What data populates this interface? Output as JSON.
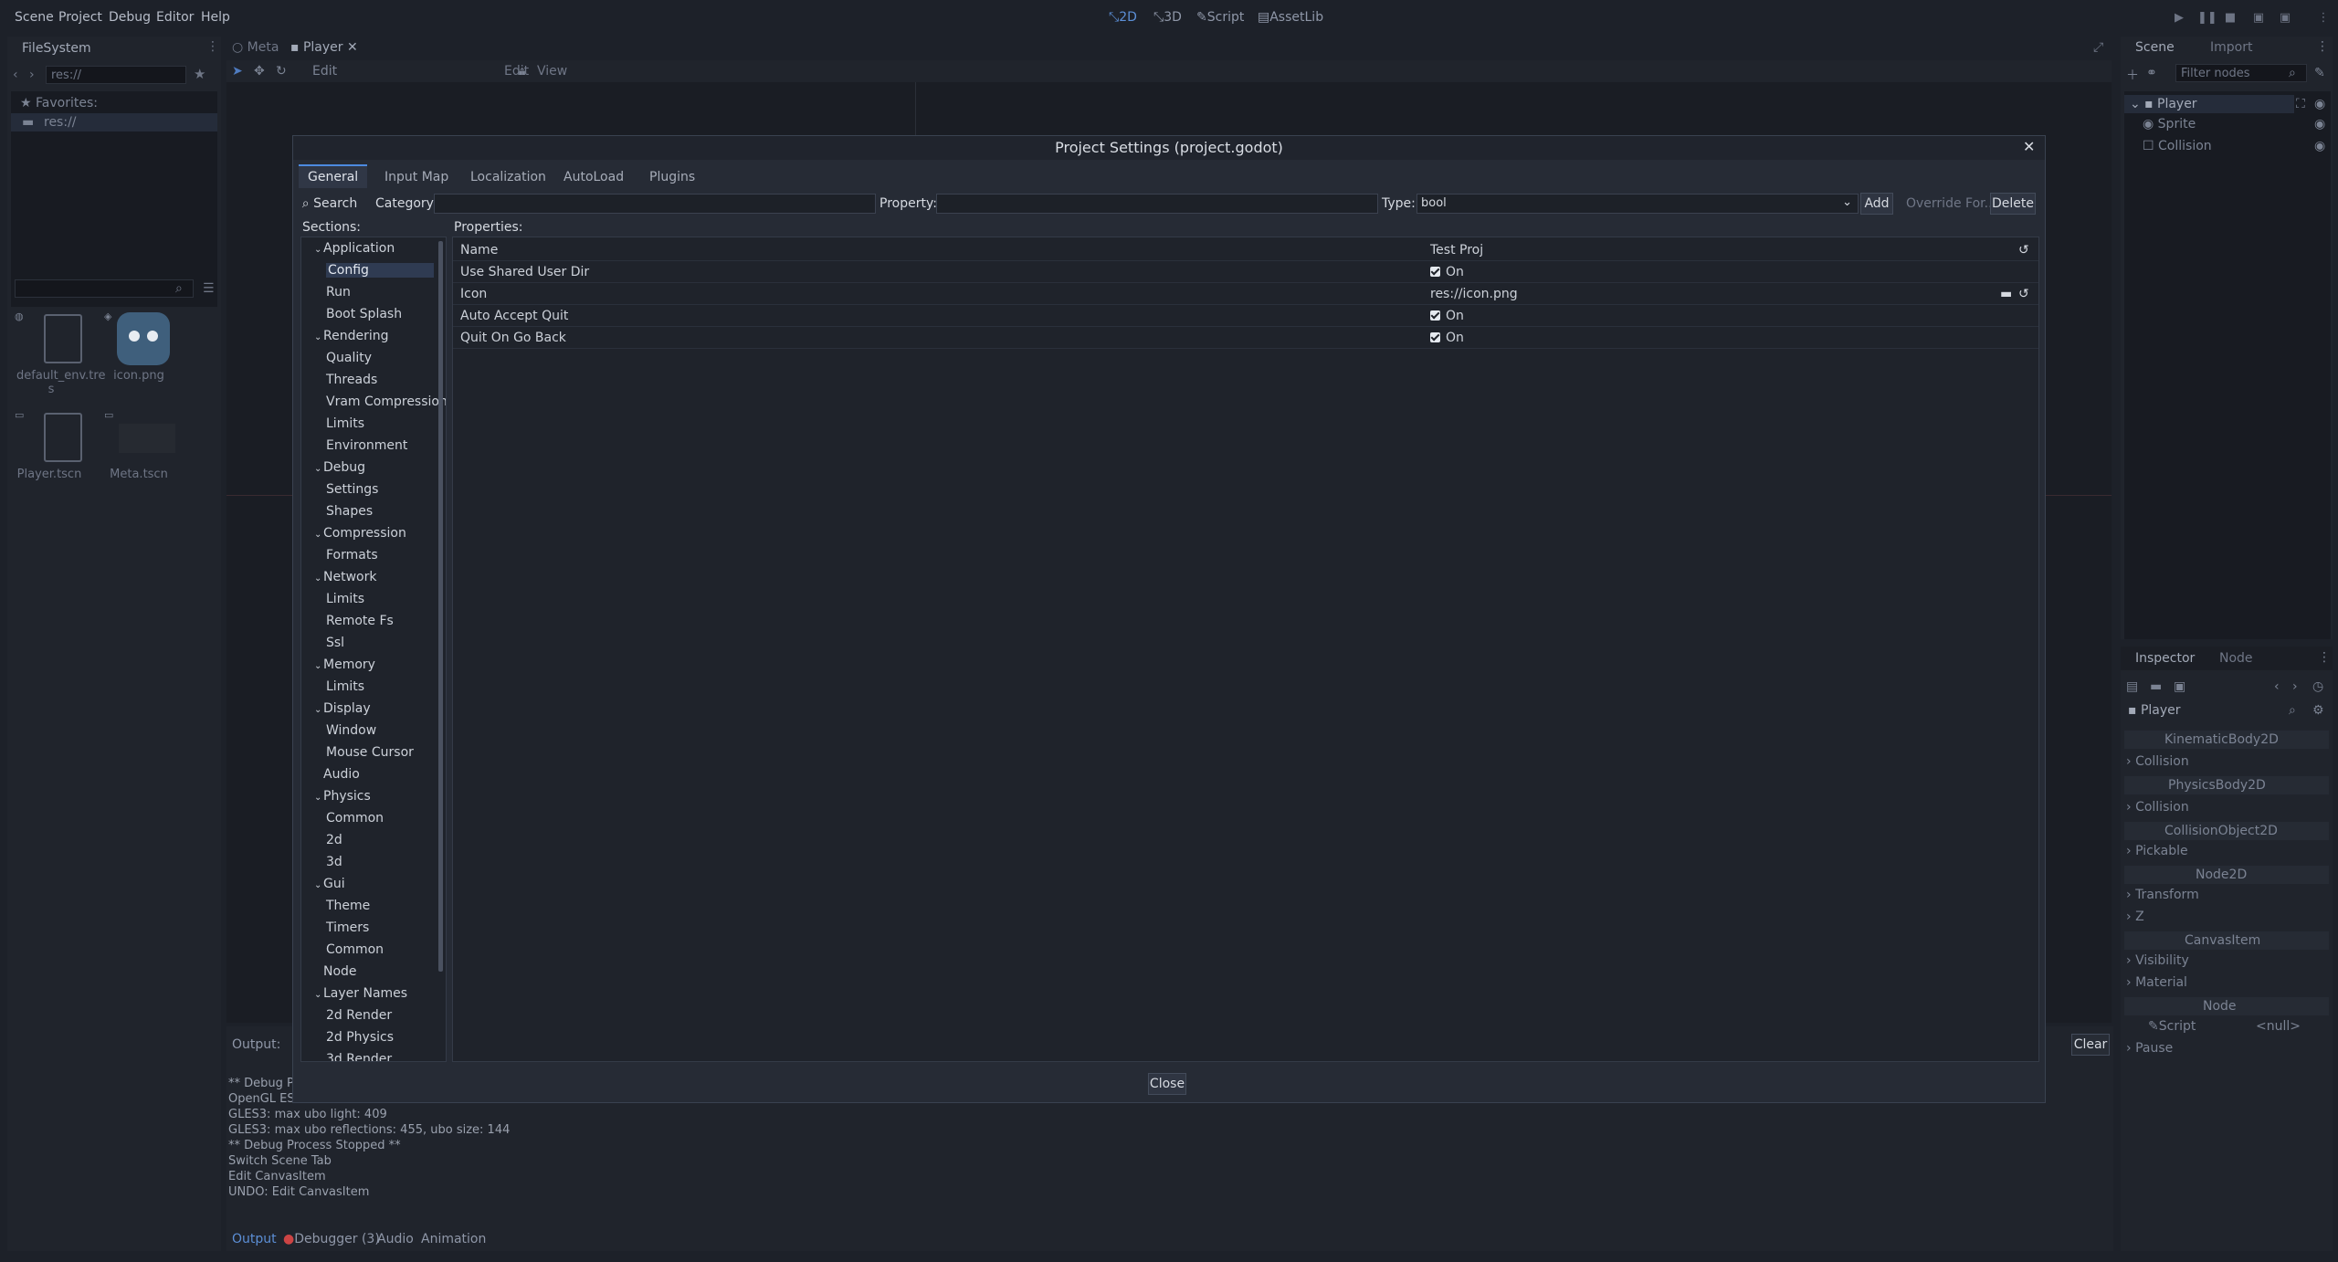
{
  "menu": [
    "Scene",
    "Project",
    "Debug",
    "Editor",
    "Help"
  ],
  "workspaces": [
    "2D",
    "3D",
    "Script",
    "AssetLib"
  ],
  "filesystem": {
    "tab": "FileSystem",
    "path": "res://",
    "favorites": "Favorites:",
    "res": "res://",
    "files": [
      "default_env.tre\ns",
      "icon.png",
      "Player.tscn",
      "Meta.tscn"
    ]
  },
  "editor_tabs": [
    "Meta",
    "Player"
  ],
  "toolbar": {
    "edit": "Edit",
    "view": "View"
  },
  "scene_dock": {
    "tabs": [
      "Scene",
      "Import"
    ],
    "filter_placeholder": "Filter nodes",
    "nodes": [
      "Player",
      "Sprite",
      "Collision"
    ]
  },
  "inspector": {
    "tabs": [
      "Inspector",
      "Node"
    ],
    "object": "Player",
    "rows": [
      "KinematicBody2D",
      "Collision",
      "PhysicsBody2D",
      "Collision",
      "CollisionObject2D",
      "Pickable",
      "Node2D",
      "Transform",
      "Z",
      "CanvasItem",
      "Visibility",
      "Material",
      "Node",
      "Script",
      "<null>",
      "Pause"
    ]
  },
  "output": {
    "label": "Output:",
    "clear": "Clear",
    "lines": [
      "** Debug P",
      "OpenGL ES",
      "GLES3: max ubo light: 409",
      "GLES3: max ubo reflections: 455, ubo size: 144",
      "** Debug Process Stopped **",
      "Switch Scene Tab",
      "Edit CanvasItem",
      "UNDO: Edit CanvasItem"
    ],
    "bottom_tabs": [
      "Output",
      "Debugger (3)",
      "Audio",
      "Animation"
    ]
  },
  "dialog": {
    "title": "Project Settings (project.godot)",
    "tabs": [
      "General",
      "Input Map",
      "Localization",
      "AutoLoad",
      "Plugins"
    ],
    "search": "Search",
    "category_label": "Category:",
    "property_label": "Property:",
    "type_label": "Type:",
    "type_value": "bool",
    "add": "Add",
    "override": "Override For...",
    "delete": "Delete",
    "sections_label": "Sections:",
    "properties_label": "Properties:",
    "sections": [
      {
        "label": "Application",
        "level": 0
      },
      {
        "label": "Config",
        "level": 1
      },
      {
        "label": "Run",
        "level": 1
      },
      {
        "label": "Boot Splash",
        "level": 1
      },
      {
        "label": "Rendering",
        "level": 0
      },
      {
        "label": "Quality",
        "level": 1
      },
      {
        "label": "Threads",
        "level": 1
      },
      {
        "label": "Vram Compression",
        "level": 1
      },
      {
        "label": "Limits",
        "level": 1
      },
      {
        "label": "Environment",
        "level": 1
      },
      {
        "label": "Debug",
        "level": 0
      },
      {
        "label": "Settings",
        "level": 1
      },
      {
        "label": "Shapes",
        "level": 1
      },
      {
        "label": "Compression",
        "level": 0
      },
      {
        "label": "Formats",
        "level": 1
      },
      {
        "label": "Network",
        "level": 0
      },
      {
        "label": "Limits",
        "level": 1
      },
      {
        "label": "Remote Fs",
        "level": 1
      },
      {
        "label": "Ssl",
        "level": 1
      },
      {
        "label": "Memory",
        "level": 0
      },
      {
        "label": "Limits",
        "level": 1
      },
      {
        "label": "Display",
        "level": 0
      },
      {
        "label": "Window",
        "level": 1
      },
      {
        "label": "Mouse Cursor",
        "level": 1
      },
      {
        "label": "Audio",
        "level": 0
      },
      {
        "label": "Physics",
        "level": 0
      },
      {
        "label": "Common",
        "level": 1
      },
      {
        "label": "2d",
        "level": 1
      },
      {
        "label": "3d",
        "level": 1
      },
      {
        "label": "Gui",
        "level": 0
      },
      {
        "label": "Theme",
        "level": 1
      },
      {
        "label": "Timers",
        "level": 1
      },
      {
        "label": "Common",
        "level": 1
      },
      {
        "label": "Node",
        "level": 0
      },
      {
        "label": "Layer Names",
        "level": 0
      },
      {
        "label": "2d Render",
        "level": 1
      },
      {
        "label": "2d Physics",
        "level": 1
      },
      {
        "label": "3d Render",
        "level": 1
      }
    ],
    "properties": [
      {
        "name": "Name",
        "value": "Test Proj",
        "kind": "text"
      },
      {
        "name": "Use Shared User Dir",
        "value": "On",
        "kind": "check"
      },
      {
        "name": "Icon",
        "value": "res://icon.png",
        "kind": "text"
      },
      {
        "name": "Auto Accept Quit",
        "value": "On",
        "kind": "check"
      },
      {
        "name": "Quit On Go Back",
        "value": "On",
        "kind": "check"
      }
    ],
    "close": "Close"
  }
}
